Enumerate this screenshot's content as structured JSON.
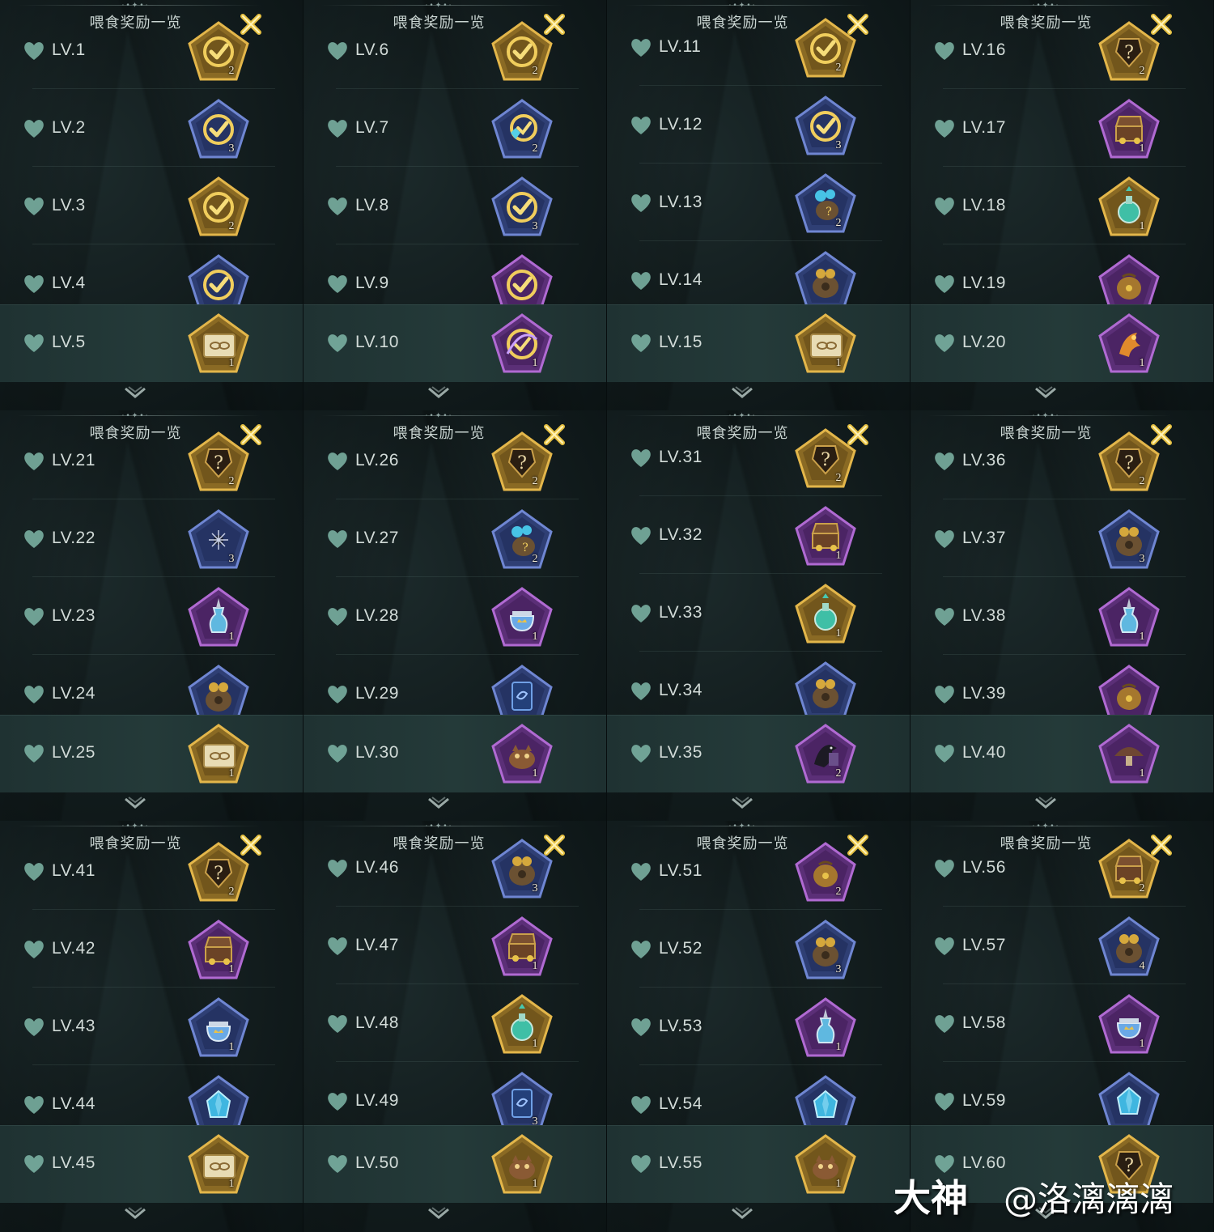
{
  "title": "喂食奖励一览",
  "watermark": {
    "brand": "大神",
    "author": "@洛漓漓漓"
  },
  "colors": {
    "gold": "#d8a93a",
    "blue": "#3a4f8c",
    "purple": "#7a3f9c",
    "heart": "#7fb7a8",
    "close": "#e7c244",
    "highlight_row": "#213535"
  },
  "panels": [
    {
      "rows": [
        {
          "level": "LV.1",
          "frame": "gold",
          "icon": "check-coin-icon",
          "qty": "2"
        },
        {
          "level": "LV.2",
          "frame": "blue",
          "icon": "check-coin-icon",
          "qty": "3"
        },
        {
          "level": "LV.3",
          "frame": "gold",
          "icon": "check-coin-icon",
          "qty": "2"
        },
        {
          "level": "LV.4",
          "frame": "blue",
          "icon": "check-coin-icon",
          "qty": ""
        },
        {
          "level": "LV.5",
          "frame": "gold",
          "icon": "ticket-icon",
          "qty": "1"
        }
      ]
    },
    {
      "rows": [
        {
          "level": "LV.6",
          "frame": "gold",
          "icon": "check-coin-icon",
          "qty": "2"
        },
        {
          "level": "LV.7",
          "frame": "blue",
          "icon": "gem-coin-icon",
          "qty": "2"
        },
        {
          "level": "LV.8",
          "frame": "blue",
          "icon": "check-coin-icon",
          "qty": "3"
        },
        {
          "level": "LV.9",
          "frame": "purple",
          "icon": "check-coin-icon",
          "qty": ""
        },
        {
          "level": "LV.10",
          "frame": "purple",
          "icon": "swirl-coin-icon",
          "qty": "1"
        }
      ]
    },
    {
      "rows": [
        {
          "level": "LV.11",
          "frame": "gold",
          "icon": "check-coin-icon",
          "qty": "2"
        },
        {
          "level": "LV.12",
          "frame": "blue",
          "icon": "check-coin-icon",
          "qty": "3"
        },
        {
          "level": "LV.13",
          "frame": "blue",
          "icon": "gem-bag-icon",
          "qty": "2"
        },
        {
          "level": "LV.14",
          "frame": "blue",
          "icon": "coin-sack-icon",
          "qty": ""
        },
        {
          "level": "LV.15",
          "frame": "gold",
          "icon": "ticket-icon",
          "qty": "1"
        }
      ]
    },
    {
      "rows": [
        {
          "level": "LV.16",
          "frame": "gold",
          "icon": "mystery-icon",
          "qty": "2"
        },
        {
          "level": "LV.17",
          "frame": "purple",
          "icon": "treasure-chest-icon",
          "qty": "1"
        },
        {
          "level": "LV.18",
          "frame": "gold",
          "icon": "potion-icon",
          "qty": "1"
        },
        {
          "level": "LV.19",
          "frame": "purple",
          "icon": "pouch-icon",
          "qty": ""
        },
        {
          "level": "LV.20",
          "frame": "purple",
          "icon": "phoenix-icon",
          "qty": "1"
        }
      ]
    },
    {
      "rows": [
        {
          "level": "LV.21",
          "frame": "gold",
          "icon": "mystery-icon",
          "qty": "2"
        },
        {
          "level": "LV.22",
          "frame": "blue",
          "icon": "spark-icon",
          "qty": "3"
        },
        {
          "level": "LV.23",
          "frame": "purple",
          "icon": "vase-potion-icon",
          "qty": "1"
        },
        {
          "level": "LV.24",
          "frame": "blue",
          "icon": "coin-sack-icon",
          "qty": ""
        },
        {
          "level": "LV.25",
          "frame": "gold",
          "icon": "ticket-icon",
          "qty": "1"
        }
      ]
    },
    {
      "rows": [
        {
          "level": "LV.26",
          "frame": "gold",
          "icon": "mystery-icon",
          "qty": "2"
        },
        {
          "level": "LV.27",
          "frame": "blue",
          "icon": "gem-bag-icon",
          "qty": "2"
        },
        {
          "level": "LV.28",
          "frame": "purple",
          "icon": "crown-jar-icon",
          "qty": "1"
        },
        {
          "level": "LV.29",
          "frame": "blue",
          "icon": "card-icon",
          "qty": ""
        },
        {
          "level": "LV.30",
          "frame": "purple",
          "icon": "creature-icon",
          "qty": "1"
        }
      ]
    },
    {
      "rows": [
        {
          "level": "LV.31",
          "frame": "gold",
          "icon": "mystery-icon",
          "qty": "2"
        },
        {
          "level": "LV.32",
          "frame": "purple",
          "icon": "treasure-chest-icon",
          "qty": "1"
        },
        {
          "level": "LV.33",
          "frame": "gold",
          "icon": "potion-icon",
          "qty": "1"
        },
        {
          "level": "LV.34",
          "frame": "blue",
          "icon": "coin-sack-icon",
          "qty": ""
        },
        {
          "level": "LV.35",
          "frame": "purple",
          "icon": "raven-icon",
          "qty": "2"
        }
      ]
    },
    {
      "rows": [
        {
          "level": "LV.36",
          "frame": "gold",
          "icon": "mystery-icon",
          "qty": "2"
        },
        {
          "level": "LV.37",
          "frame": "blue",
          "icon": "coin-sack-icon",
          "qty": "3"
        },
        {
          "level": "LV.38",
          "frame": "purple",
          "icon": "vase-potion-icon",
          "qty": "1"
        },
        {
          "level": "LV.39",
          "frame": "purple",
          "icon": "pouch-icon",
          "qty": ""
        },
        {
          "level": "LV.40",
          "frame": "purple",
          "icon": "mushroom-icon",
          "qty": "1"
        }
      ]
    },
    {
      "rows": [
        {
          "level": "LV.41",
          "frame": "gold",
          "icon": "mystery-icon",
          "qty": "2"
        },
        {
          "level": "LV.42",
          "frame": "purple",
          "icon": "treasure-chest-icon",
          "qty": "1"
        },
        {
          "level": "LV.43",
          "frame": "blue",
          "icon": "crown-jar-icon",
          "qty": "1"
        },
        {
          "level": "LV.44",
          "frame": "blue",
          "icon": "crystal-icon",
          "qty": ""
        },
        {
          "level": "LV.45",
          "frame": "gold",
          "icon": "ticket-icon",
          "qty": "1"
        }
      ]
    },
    {
      "rows": [
        {
          "level": "LV.46",
          "frame": "blue",
          "icon": "coin-sack-icon",
          "qty": "3"
        },
        {
          "level": "LV.47",
          "frame": "purple",
          "icon": "treasure-chest-icon",
          "qty": "1"
        },
        {
          "level": "LV.48",
          "frame": "gold",
          "icon": "potion-icon",
          "qty": "1"
        },
        {
          "level": "LV.49",
          "frame": "blue",
          "icon": "card-icon",
          "qty": "3"
        },
        {
          "level": "LV.50",
          "frame": "gold",
          "icon": "creature-icon",
          "qty": "1"
        }
      ]
    },
    {
      "rows": [
        {
          "level": "LV.51",
          "frame": "purple",
          "icon": "pouch-icon",
          "qty": "2"
        },
        {
          "level": "LV.52",
          "frame": "blue",
          "icon": "coin-sack-icon",
          "qty": "3"
        },
        {
          "level": "LV.53",
          "frame": "purple",
          "icon": "vase-potion-icon",
          "qty": "1"
        },
        {
          "level": "LV.54",
          "frame": "blue",
          "icon": "crystal-icon",
          "qty": ""
        },
        {
          "level": "LV.55",
          "frame": "gold",
          "icon": "creature-icon",
          "qty": "1"
        }
      ]
    },
    {
      "rows": [
        {
          "level": "LV.56",
          "frame": "gold",
          "icon": "treasure-chest-icon",
          "qty": "2"
        },
        {
          "level": "LV.57",
          "frame": "blue",
          "icon": "coin-sack-icon",
          "qty": "4"
        },
        {
          "level": "LV.58",
          "frame": "purple",
          "icon": "crown-jar-icon",
          "qty": "1"
        },
        {
          "level": "LV.59",
          "frame": "blue",
          "icon": "crystal-icon",
          "qty": ""
        },
        {
          "level": "LV.60",
          "frame": "gold",
          "icon": "mystery-icon",
          "qty": ""
        }
      ]
    }
  ]
}
